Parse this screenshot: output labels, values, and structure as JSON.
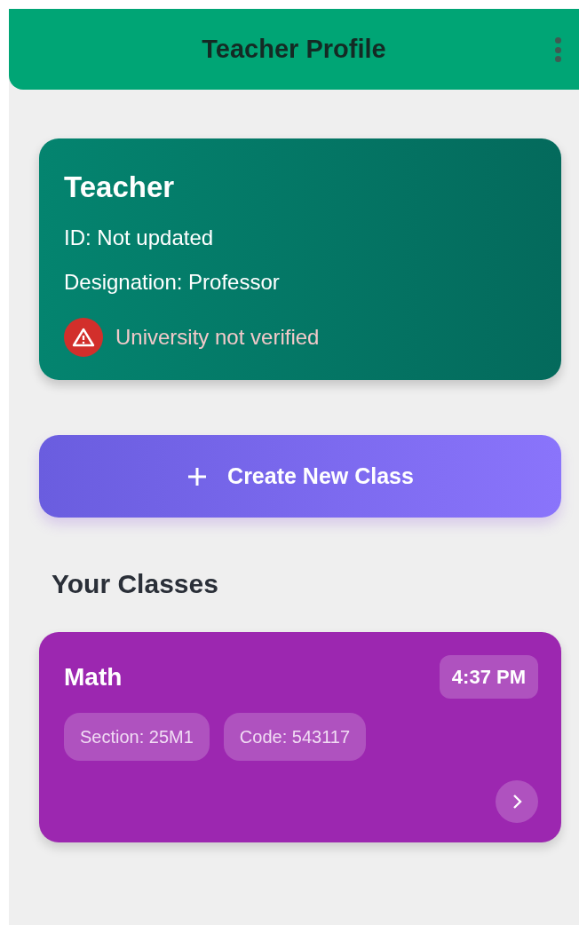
{
  "app_bar": {
    "title": "Teacher Profile"
  },
  "profile": {
    "name": "Teacher",
    "id_line": "ID: Not updated",
    "designation_line": "Designation: Professor",
    "verification": {
      "verified": false,
      "text": "University not verified"
    }
  },
  "create_button": {
    "label": "Create New Class"
  },
  "section_title": "Your Classes",
  "classes": [
    {
      "name": "Math",
      "time": "4:37 PM",
      "tags": [
        "Section: 25M1",
        "Code: 543117"
      ]
    }
  ]
}
